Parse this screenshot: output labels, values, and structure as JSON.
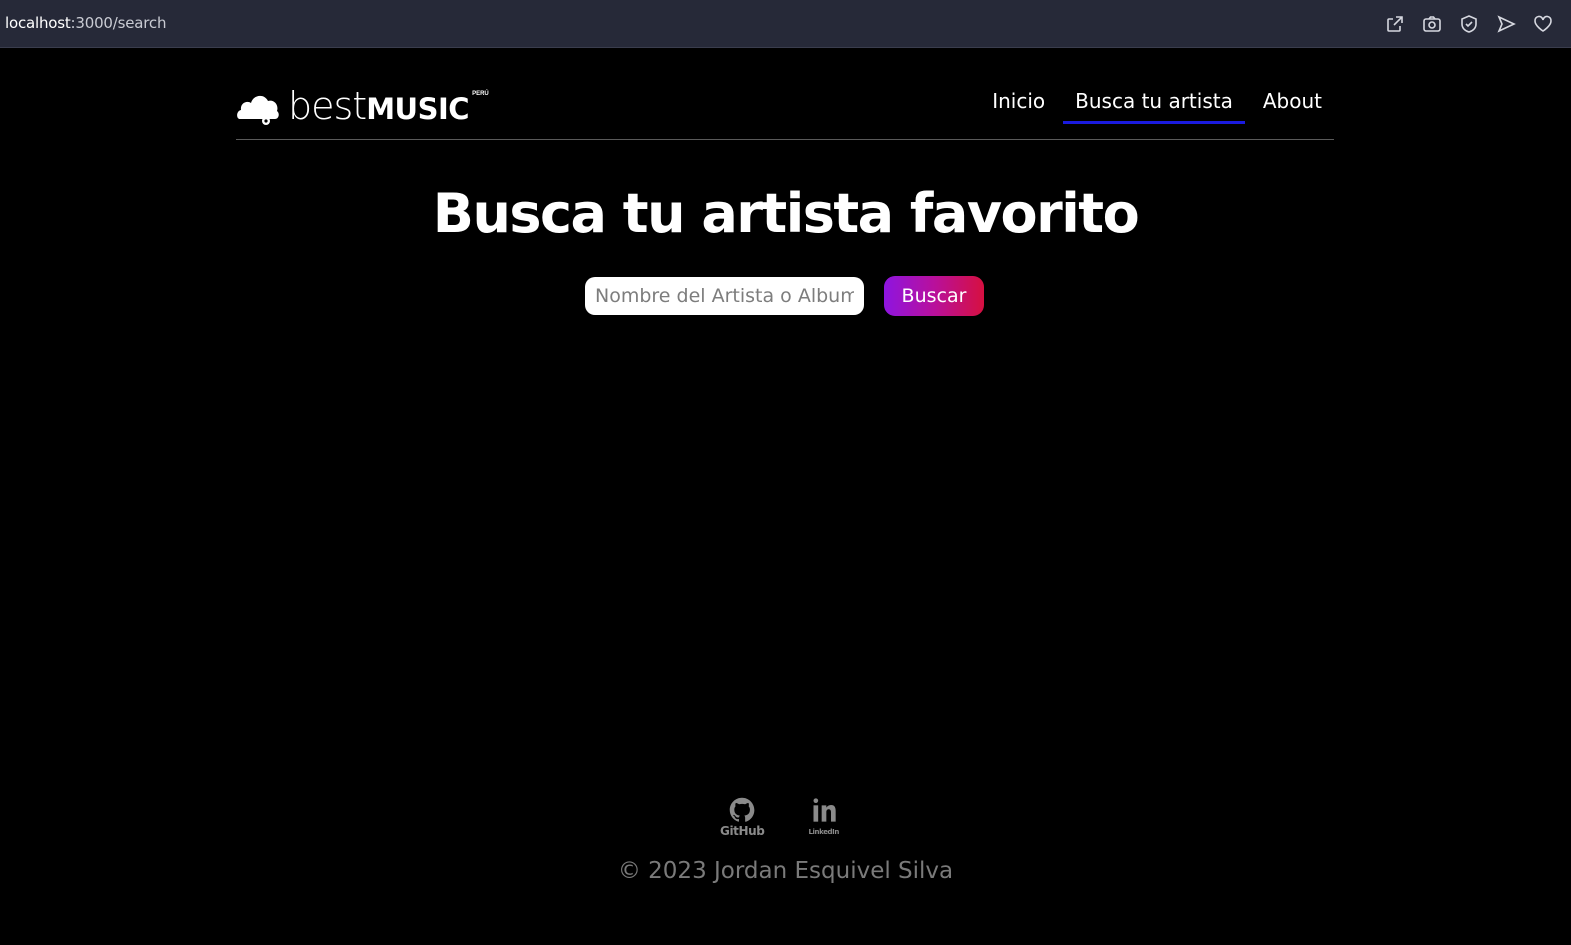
{
  "browser": {
    "url_host": "localhost",
    "url_path": ":3000/search",
    "icons": [
      "share-icon",
      "camera-icon",
      "shield-icon",
      "send-icon",
      "heart-icon"
    ]
  },
  "header": {
    "logo": {
      "best": "best",
      "music": "MUSIC",
      "region": "PERÚ"
    },
    "nav": [
      {
        "label": "Inicio",
        "active": false
      },
      {
        "label": "Busca tu artista",
        "active": true
      },
      {
        "label": "About",
        "active": false
      }
    ],
    "active_color": "#1a1adf"
  },
  "main": {
    "title": "Busca tu artista favorito",
    "search": {
      "placeholder": "Nombre del Artista o Album",
      "value": ""
    },
    "button_label": "Buscar",
    "button_gradient": [
      "#8e15e0",
      "#d61040"
    ]
  },
  "footer": {
    "social": [
      {
        "icon": "github-icon",
        "label": "GitHub"
      },
      {
        "icon": "linkedin-icon",
        "label": "LinkedIn"
      }
    ],
    "copyright": "© 2023 Jordan Esquivel Silva"
  }
}
